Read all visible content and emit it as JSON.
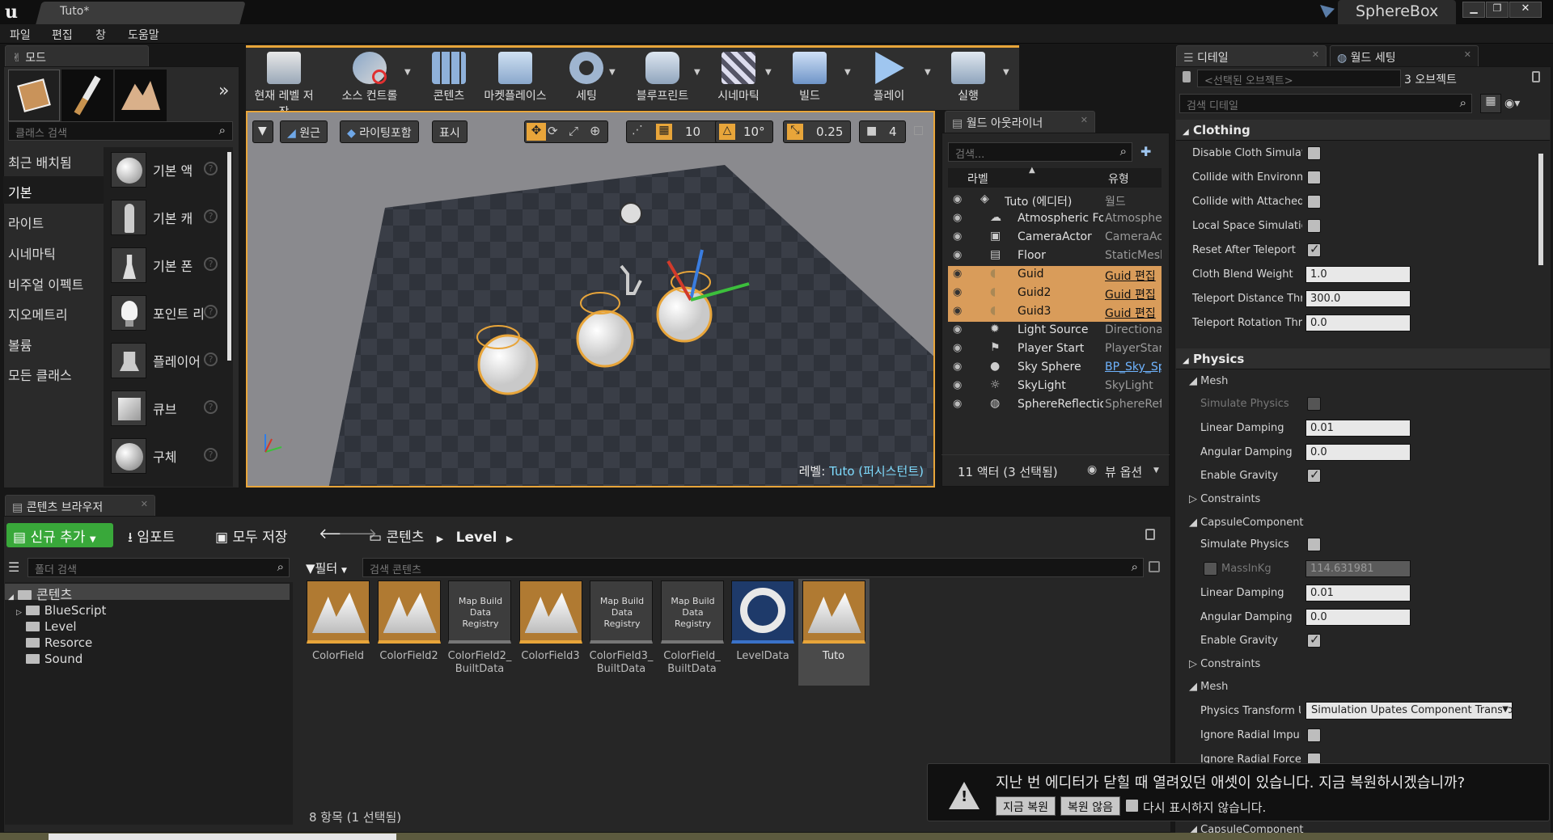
{
  "window": {
    "tab_title": "Tuto*",
    "app_title": "SphereBox"
  },
  "menu": [
    "파일",
    "편집",
    "창",
    "도움말"
  ],
  "modes": {
    "tab_label": "모드",
    "search_placeholder": "클래스 검색",
    "categories": [
      "최근 배치됨",
      "기본",
      "라이트",
      "시네마틱",
      "비주얼 이펙트",
      "지오메트리",
      "볼륨",
      "모든 클래스"
    ],
    "selected_category": "기본",
    "items": [
      "기본 액터",
      "기본 캐릭터",
      "기본 폰",
      "포인트 라이트",
      "플레이어 스타트",
      "큐브",
      "구체"
    ],
    "items_visible": [
      "기본 액",
      "기본 캐",
      "기본 폰",
      "포인트 리",
      "플레이어",
      "큐브",
      "구체"
    ]
  },
  "toolbar": {
    "buttons": [
      "현재 레벨 저장",
      "소스 컨트롤",
      "콘텐츠",
      "마켓플레이스",
      "세팅",
      "블루프린트",
      "시네마틱",
      "빌드",
      "플레이",
      "실행"
    ]
  },
  "viewport": {
    "perspective": "원근",
    "lighting": "라이팅포함",
    "show": "표시",
    "grid_snap": "10",
    "rot_snap": "10°",
    "scale_snap": "0.25",
    "cam_speed": "4",
    "level_label": "레벨:",
    "level_name": "Tuto (퍼시스턴트)"
  },
  "outliner": {
    "tab_label": "월드 아웃라이너",
    "search_placeholder": "검색...",
    "col_label": "라벨",
    "col_type": "유형",
    "rows": [
      {
        "label": "Tuto (에디터)",
        "type": "월드",
        "selected": false,
        "link": false
      },
      {
        "label": "Atmospheric Fog",
        "type": "AtmosphericFog",
        "selected": false,
        "link": false
      },
      {
        "label": "CameraActor",
        "type": "CameraActor",
        "selected": false,
        "link": false
      },
      {
        "label": "Floor",
        "type": "StaticMeshActor",
        "selected": false,
        "link": false
      },
      {
        "label": "Guid",
        "type": "Guid 편집",
        "selected": true,
        "link": true
      },
      {
        "label": "Guid2",
        "type": "Guid 편집",
        "selected": true,
        "link": true
      },
      {
        "label": "Guid3",
        "type": "Guid 편집",
        "selected": true,
        "link": true
      },
      {
        "label": "Light Source",
        "type": "DirectionalLight",
        "selected": false,
        "link": false
      },
      {
        "label": "Player Start",
        "type": "PlayerStart",
        "selected": false,
        "link": false
      },
      {
        "label": "Sky Sphere",
        "type": "BP_Sky_Sphere",
        "selected": false,
        "link": true
      },
      {
        "label": "SkyLight",
        "type": "SkyLight",
        "selected": false,
        "link": false
      },
      {
        "label": "SphereReflectionCapture",
        "type": "SphereReflectionCapture",
        "selected": false,
        "link": false
      }
    ],
    "footer": "11 액터 (3 선택됨)",
    "view_options": "뷰 옵션"
  },
  "details": {
    "tab_label": "디테일",
    "world_tab_label": "월드 세팅",
    "selected_placeholder": "<선택된 오브젝트>",
    "count": "3 오브젝트",
    "search_placeholder": "검색 디테일",
    "clothing_title": "Clothing",
    "clothing": [
      {
        "label": "Disable Cloth Simulation",
        "checked": false
      },
      {
        "label": "Collide with Environment",
        "checked": false
      },
      {
        "label": "Collide with Attached Children",
        "checked": false
      },
      {
        "label": "Local Space Simulation",
        "checked": false
      },
      {
        "label": "Reset After Teleport",
        "checked": true
      }
    ],
    "cloth_values": [
      {
        "label": "Cloth Blend Weight",
        "value": "1.0"
      },
      {
        "label": "Teleport Distance Threshold",
        "value": "300.0"
      },
      {
        "label": "Teleport Rotation Threshold",
        "value": "0.0"
      }
    ],
    "physics_title": "Physics",
    "mesh_label": "Mesh",
    "simulate_physics": "Simulate Physics",
    "linear_damping": "Linear Damping",
    "angular_damping": "Angular Damping",
    "enable_gravity": "Enable Gravity",
    "constraints": "Constraints",
    "capsule": "CapsuleComponent",
    "mass": "MassInKg",
    "physics_transform": "Physics Transform Update Mode",
    "ignore_radial_impulse": "Ignore Radial Impulse",
    "ignore_radial_force": "Ignore Radial Force",
    "mesh_linear": "0.01",
    "mesh_angular": "0.0",
    "mass_value": "114.631981",
    "cap_linear": "0.01",
    "cap_angular": "0.0",
    "transform_value": "Simulation Upates Component Transform"
  },
  "content_browser": {
    "tab_label": "콘텐츠 브라우저",
    "add_new": "신규 추가",
    "import": "임포트",
    "save_all": "모두 저장",
    "breadcrumb": [
      "콘텐츠",
      "Level"
    ],
    "folder_search_placeholder": "폴더 검색",
    "filter": "필터",
    "content_search_placeholder": "검색 콘텐츠",
    "tree": [
      "콘텐츠",
      "BlueScript",
      "Level",
      "Resorce",
      "Sound"
    ],
    "assets": [
      {
        "name": "ColorField",
        "kind": "map"
      },
      {
        "name": "ColorField2",
        "kind": "map"
      },
      {
        "name": "ColorField2_\nBuiltData",
        "kind": "registry"
      },
      {
        "name": "ColorField3",
        "kind": "map"
      },
      {
        "name": "ColorField3_\nBuiltData",
        "kind": "registry"
      },
      {
        "name": "ColorField_\nBuiltData",
        "kind": "registry"
      },
      {
        "name": "LevelData",
        "kind": "ring"
      },
      {
        "name": "Tuto",
        "kind": "map"
      }
    ],
    "registry_label": "Map Build Data Registry",
    "footer": "8 항목 (1 선택됨)"
  },
  "notification": {
    "message": "지난 번 에디터가 닫힐 때 열려있던 애셋이 있습니다. 지금 복원하시겠습니까?",
    "restore": "지금 복원",
    "dont_restore": "복원 않음",
    "dont_show": "다시 표시하지 않습니다."
  },
  "colors": {
    "accent": "#d99c5a",
    "viewport_border": "#e8a53a",
    "add_button": "#39a83a",
    "link": "#6fb4ff"
  }
}
